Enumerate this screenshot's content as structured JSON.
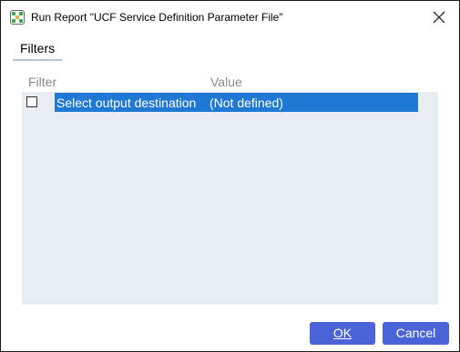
{
  "window": {
    "title": "Run Report \"UCF Service Definition Parameter File\"",
    "app_icon": "app-grid-icon",
    "close_icon": "close-icon"
  },
  "tabs": [
    {
      "label": "Filters",
      "active": true
    }
  ],
  "grid": {
    "columns": [
      "Filter",
      "Value"
    ],
    "rows": [
      {
        "checked": false,
        "filter": "Select output destination",
        "value": "(Not defined)",
        "selected": true
      }
    ]
  },
  "buttons": {
    "ok_label": "OK",
    "cancel_label": "Cancel"
  },
  "colors": {
    "accent_button": "#4a63d8",
    "selection": "#1e78d4",
    "grid_background": "#e8ecf3"
  }
}
